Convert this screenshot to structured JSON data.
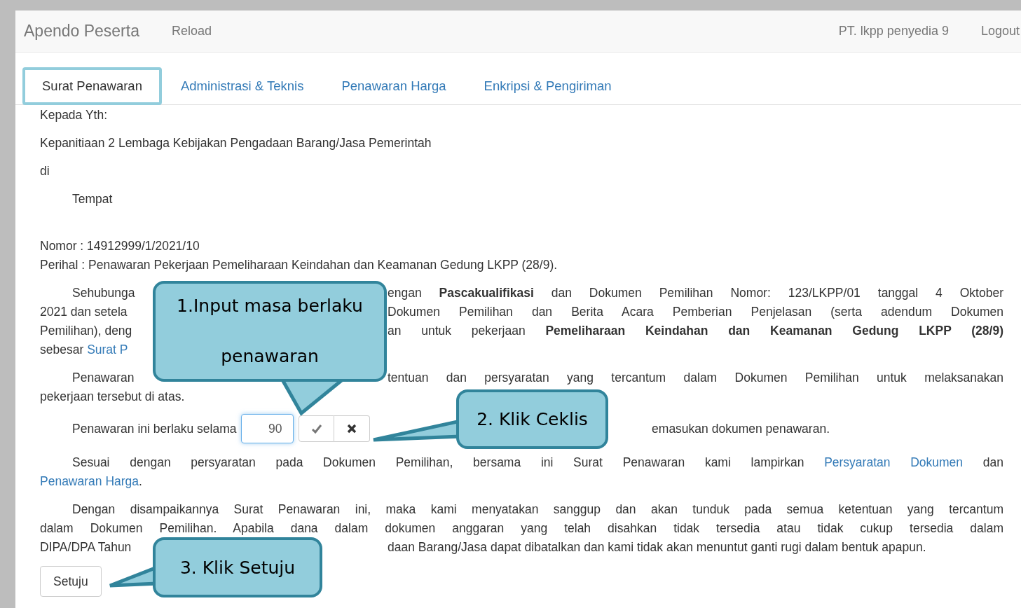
{
  "navbar": {
    "brand": "Apendo Peserta",
    "links": [
      "Reload"
    ],
    "user": "PT. lkpp penyedia 9",
    "logout": "Logout"
  },
  "tabs": [
    {
      "label": "Surat Penawaran",
      "selected": true
    },
    {
      "label": "Administrasi & Teknis",
      "selected": false
    },
    {
      "label": "Penawaran Harga",
      "selected": false
    },
    {
      "label": "Enkripsi & Pengiriman",
      "selected": false
    }
  ],
  "address": [
    "Kepada Yth:",
    "Kepanitiaan 2 Lembaga Kebijakan Pengadaan Barang/Jasa Pemerintah",
    "di"
  ],
  "place": "Tempat",
  "subject": [
    "Nomor : 14912999/1/2021/10",
    "Perihal : Penawaran Pekerjaan Pemeliharaan Keindahan dan Keamanan Gedung LKPP (28/9)."
  ],
  "paragraphs_before": [
    {
      "lines": [
        {
          "before_callout": "Sehubunga",
          "after_callout": "engan **Pascakualifikasi** dan Dokumen Pemilihan Nomor: 123/LKPP/01 tanggal 4 Oktober"
        },
        {
          "before_callout": "2021 dan setela",
          "after_callout": "Dokumen Pemilihan dan Berita Acara Pemberian Penjelasan (serta adendum Dokumen"
        },
        {
          "before_callout": "Pemilihan), deng",
          "after_callout": "an untuk pekerjaan **Pemeliharaan Keindahan dan Keamanan Gedung LKPP (28/9)**"
        },
        {
          "segments": [
            {
              "kind": "text",
              "text": "sebesar "
            },
            {
              "kind": "link",
              "text": "Surat P"
            }
          ]
        }
      ]
    },
    {
      "lines": [
        {
          "before_callout": "Penawaran",
          "after_callout": "tentuan dan persyaratan yang tercantum dalam Dokumen Pemilihan untuk melaksanakan"
        },
        {
          "segments": [
            {
              "kind": "text",
              "text": "pekerjaan tersebut di atas."
            }
          ]
        }
      ]
    }
  ],
  "validity": {
    "label": "Penawaran ini berlaku selama",
    "value": "90",
    "after": "emasukan dokumen penawaran."
  },
  "paragraphs_after": [
    {
      "lines": [
        {
          "segments": [
            {
              "kind": "text",
              "text": "Sesuai dengan persyaratan pada Dokumen Pemilihan, bersama ini Surat Penawaran kami lampirkan "
            },
            {
              "kind": "link",
              "text": "Persyaratan Dokumen"
            },
            {
              "kind": "text",
              "text": " dan"
            }
          ]
        },
        {
          "segments": [
            {
              "kind": "link",
              "text": "Penawaran Harga"
            },
            {
              "kind": "text",
              "text": "."
            }
          ]
        }
      ]
    },
    {
      "lines": [
        {
          "segments": [
            {
              "kind": "text",
              "text": "Dengan disampaikannya Surat Penawaran ini, maka kami menyatakan sanggup dan akan tunduk pada semua ketentuan yang tercantum"
            }
          ]
        },
        {
          "segments": [
            {
              "kind": "text",
              "text": "dalam Dokumen Pemilihan. Apabila dana dalam dokumen anggaran yang telah disahkan tidak tersedia atau tidak cukup tersedia dalam"
            }
          ]
        },
        {
          "before_callout": "DIPA/DPA Tahun",
          "after_callout": "daan Barang/Jasa dapat dibatalkan dan kami tidak akan menuntut ganti rugi dalam bentuk apapun."
        }
      ]
    }
  ],
  "submit": "Setuju",
  "callouts": [
    "1.Input masa berlaku penawaran",
    "2. Klik Ceklis",
    "3. Klik Setuju"
  ]
}
